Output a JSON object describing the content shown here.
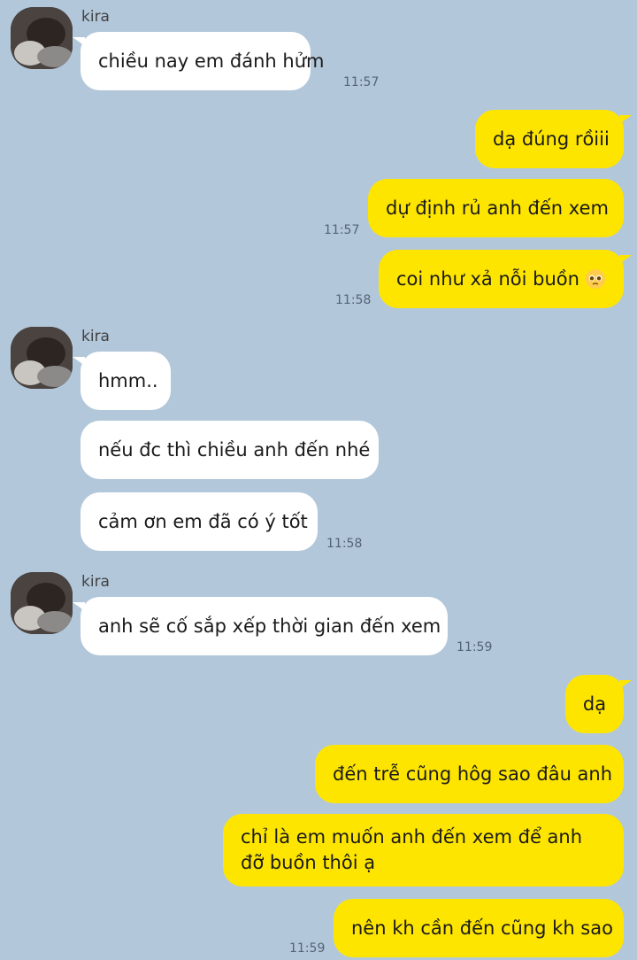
{
  "chat": {
    "contact_name": "kira",
    "groups": [
      {
        "sender": "kira",
        "messages": [
          "chiều nay em đánh hửm"
        ],
        "time": "11:57"
      },
      {
        "sender": "me",
        "messages": [
          "dạ đúng rồiii",
          "dự định rủ anh đến xem"
        ],
        "time": "11:57"
      },
      {
        "sender": "me",
        "messages": [
          "coi như xả nỗi buồn"
        ],
        "emoji": "pleading-face-icon",
        "time": "11:58"
      },
      {
        "sender": "kira",
        "messages": [
          "hmm..",
          "nếu đc thì chiều anh đến nhé",
          "cảm ơn em đã có ý tốt"
        ],
        "time": "11:58"
      },
      {
        "sender": "kira",
        "messages": [
          "anh sẽ cố sắp xếp thời gian đến xem"
        ],
        "time": "11:59"
      },
      {
        "sender": "me",
        "messages": [
          "dạ",
          "đến trễ cũng hôg sao đâu anh",
          "chỉ là em muốn anh đến xem để anh đỡ buồn thôi ạ",
          "nên kh cần đến cũng kh sao"
        ],
        "time": "11:59"
      }
    ]
  },
  "colors": {
    "background": "#b2c7da",
    "incoming_bubble": "#ffffff",
    "outgoing_bubble": "#fee500",
    "timestamp": "#556474"
  }
}
